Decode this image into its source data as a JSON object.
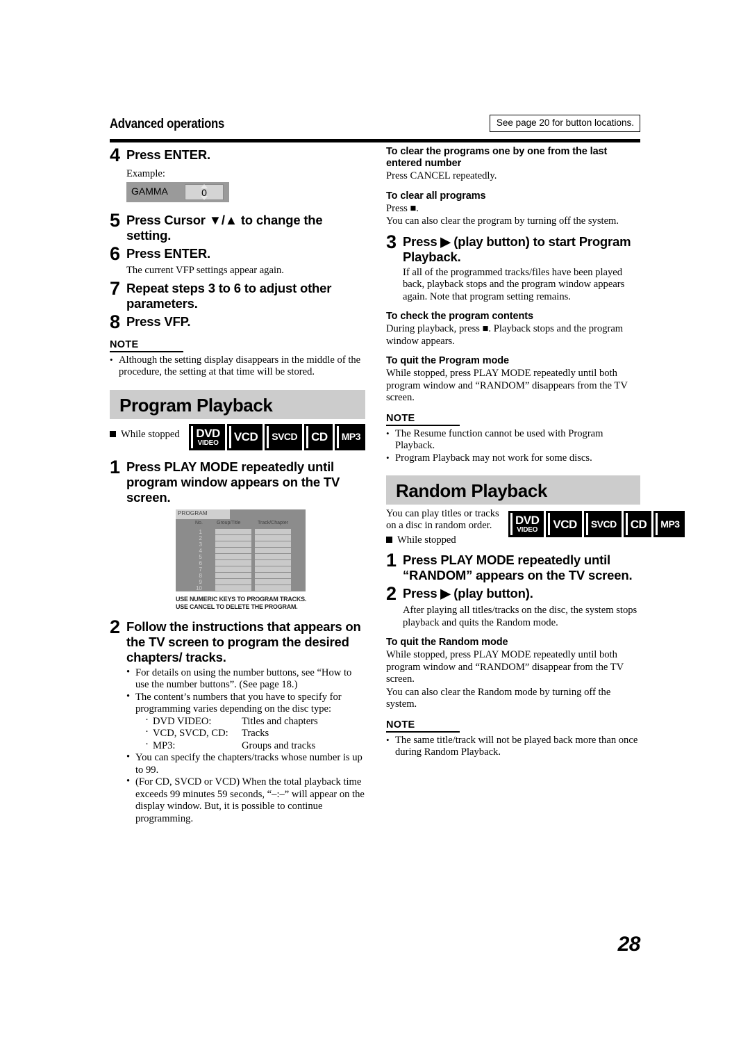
{
  "header": {
    "title": "Advanced operations",
    "note_box": "See page 20 for button locations."
  },
  "page_number": "28",
  "left_column": {
    "step4": {
      "num": "4",
      "text": "Press ENTER.",
      "example_label": "Example:",
      "gamma_widget": {
        "label": "GAMMA",
        "value": "0"
      }
    },
    "step5": {
      "num": "5",
      "text": "Press Cursor ▼/▲ to change the setting."
    },
    "step6": {
      "num": "6",
      "text": "Press ENTER.",
      "body": "The current VFP settings appear again."
    },
    "step7": {
      "num": "7",
      "text": "Repeat steps 3 to 6 to adjust other parameters."
    },
    "step8": {
      "num": "8",
      "text": "Press VFP."
    },
    "note": {
      "head": "NOTE",
      "items": [
        "Although the setting display disappears in the middle of the procedure, the setting at that time will be stored."
      ]
    },
    "program_section": {
      "banner": "Program Playback",
      "while_stopped": "While stopped",
      "badges": [
        {
          "main": "DVD",
          "sub": "VIDEO"
        },
        {
          "main": "VCD",
          "sub": ""
        },
        {
          "main": "SVCD",
          "sub": ""
        },
        {
          "main": "CD",
          "sub": ""
        },
        {
          "main": "MP3",
          "sub": ""
        }
      ],
      "step1": {
        "num": "1",
        "text": "Press PLAY MODE repeatedly until program window appears on the TV screen."
      },
      "program_window": {
        "tab_label": "PROGRAM",
        "columns": [
          "No.",
          "Group/Title",
          "Track/Chapter"
        ],
        "rows": [
          "1",
          "2",
          "3",
          "4",
          "5",
          "6",
          "7",
          "8",
          "9",
          "10"
        ],
        "caption_line1": "USE NUMERIC KEYS TO PROGRAM TRACKS.",
        "caption_line2": "USE CANCEL TO DELETE THE PROGRAM."
      },
      "step2": {
        "num": "2",
        "text": "Follow the instructions that appears on the TV screen to program the desired chapters/ tracks.",
        "bullets": [
          "For details on using the number buttons, see “How to use the number buttons”. (See page 18.)",
          "The content’s numbers that you have to specify for programming varies depending on the disc type:",
          "You can specify the chapters/tracks whose number is up to 99.",
          "(For CD, SVCD or VCD) When the total playback time exceeds 99 minutes 59 seconds, “–:–” will appear on the display window. But, it is possible to continue programming."
        ],
        "disc_types": [
          {
            "type": "DVD VIDEO:",
            "content": "Titles and chapters"
          },
          {
            "type": "VCD, SVCD, CD:",
            "content": "Tracks"
          },
          {
            "type": "MP3:",
            "content": "Groups and tracks"
          }
        ]
      }
    }
  },
  "right_column": {
    "clear_one_by_one": {
      "head": "To clear the programs one by one from the last entered number",
      "body": "Press CANCEL repeatedly."
    },
    "clear_all": {
      "head": "To clear all programs",
      "body_line1": "Press ■.",
      "body_line2": "You can also clear the program by turning off the system."
    },
    "step3": {
      "num": "3",
      "text": "Press ▶ (play button) to start Program Playback.",
      "body": "If all of the programmed tracks/files have been played back, playback stops and the program window appears again. Note that program setting remains."
    },
    "check_contents": {
      "head": "To check the program contents",
      "body": "During playback, press ■. Playback stops and the program window appears."
    },
    "quit_program": {
      "head": "To quit the Program mode",
      "body": "While stopped, press PLAY MODE repeatedly until both program window and “RANDOM” disappears from the TV screen."
    },
    "note": {
      "head": "NOTE",
      "items": [
        "The Resume function cannot be used with Program Playback.",
        "Program Playback may not work for some discs."
      ]
    },
    "random_section": {
      "banner": "Random Playback",
      "intro": "You can play titles or tracks on a disc in random order.",
      "while_stopped": "While stopped",
      "badges": [
        {
          "main": "DVD",
          "sub": "VIDEO"
        },
        {
          "main": "VCD",
          "sub": ""
        },
        {
          "main": "SVCD",
          "sub": ""
        },
        {
          "main": "CD",
          "sub": ""
        },
        {
          "main": "MP3",
          "sub": ""
        }
      ],
      "step1": {
        "num": "1",
        "text": "Press PLAY MODE repeatedly until “RANDOM” appears on the TV screen."
      },
      "step2": {
        "num": "2",
        "text": "Press ▶ (play button).",
        "body": "After playing all titles/tracks on the disc, the system stops playback and quits the Random mode."
      },
      "quit_random": {
        "head": "To quit the Random mode",
        "body_line1": "While stopped, press PLAY MODE repeatedly until both program window and “RANDOM” disappear from the TV screen.",
        "body_line2": "You can also clear the Random mode by turning off the system."
      },
      "note": {
        "head": "NOTE",
        "items": [
          "The same title/track will not be played back more than once during Random Playback."
        ]
      }
    }
  }
}
